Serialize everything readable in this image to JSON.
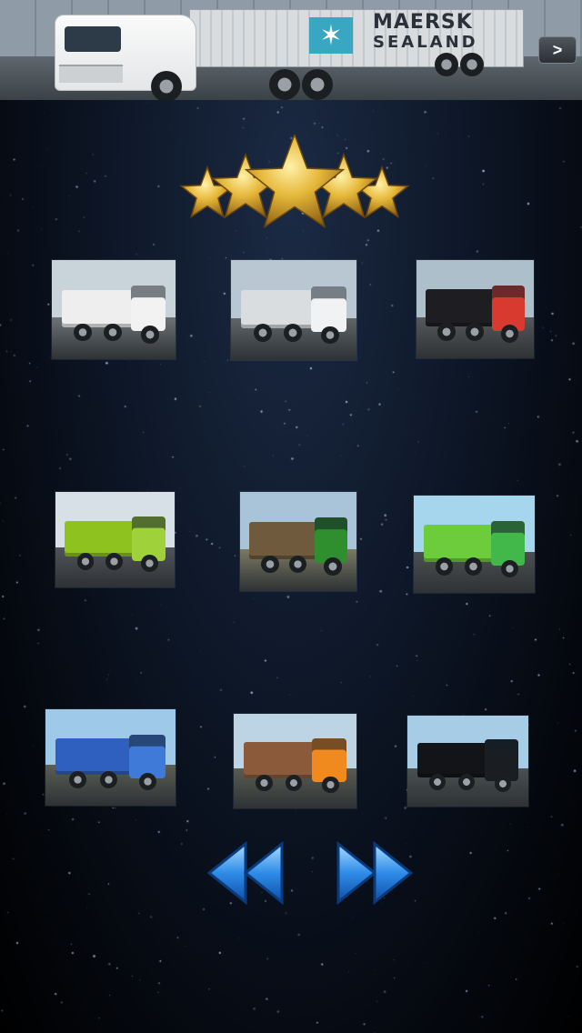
{
  "banner": {
    "brand_line1": "MAERSK",
    "brand_line2": "SEALAND",
    "logo_glyph": "✶",
    "next_label": ">"
  },
  "rating": {
    "stars": 5,
    "max": 5,
    "color": "#e2b33a"
  },
  "skins": [
    {
      "id": "cement-mixer",
      "sky": "#c9d3da",
      "road": "#6d7276",
      "body": "#eeeeee",
      "cab": "#f2f2f2"
    },
    {
      "id": "maersk-container",
      "sky": "#b9c7d2",
      "road": "#5f6569",
      "body": "#d9dde0",
      "cab": "#f0f2f4"
    },
    {
      "id": "red-black-cargo",
      "sky": "#aebfcc",
      "road": "#55595c",
      "body": "#1e1e22",
      "cab": "#d93a30"
    },
    {
      "id": "green-trailer",
      "sky": "#d6e0e6",
      "road": "#505458",
      "body": "#8ec21e",
      "cab": "#9fd23a"
    },
    {
      "id": "green-front-cargo",
      "sky": "#a9c3d8",
      "road": "#7a7a62",
      "body": "#6f5a3e",
      "cab": "#2f8f2e"
    },
    {
      "id": "green-truck-road",
      "sky": "#a5d6ee",
      "road": "#4c5052",
      "body": "#6ccc3c",
      "cab": "#43b84a"
    },
    {
      "id": "blue-orange-cargo",
      "sky": "#9fc9e8",
      "road": "#5b5e55",
      "body": "#2f5fbf",
      "cab": "#3f7ad9"
    },
    {
      "id": "orange-flatbed",
      "sky": "#bcd4e4",
      "road": "#5a5c52",
      "body": "#8b5a3a",
      "cab": "#f08a1e"
    },
    {
      "id": "graffiti-trailer",
      "sky": "#a7cde6",
      "road": "#4b5052",
      "body": "#121418",
      "cab": "#1a1d22"
    }
  ],
  "navigation": {
    "prev_label": "previous",
    "next_label": "next",
    "arrow_color": "#2f8ce8"
  }
}
